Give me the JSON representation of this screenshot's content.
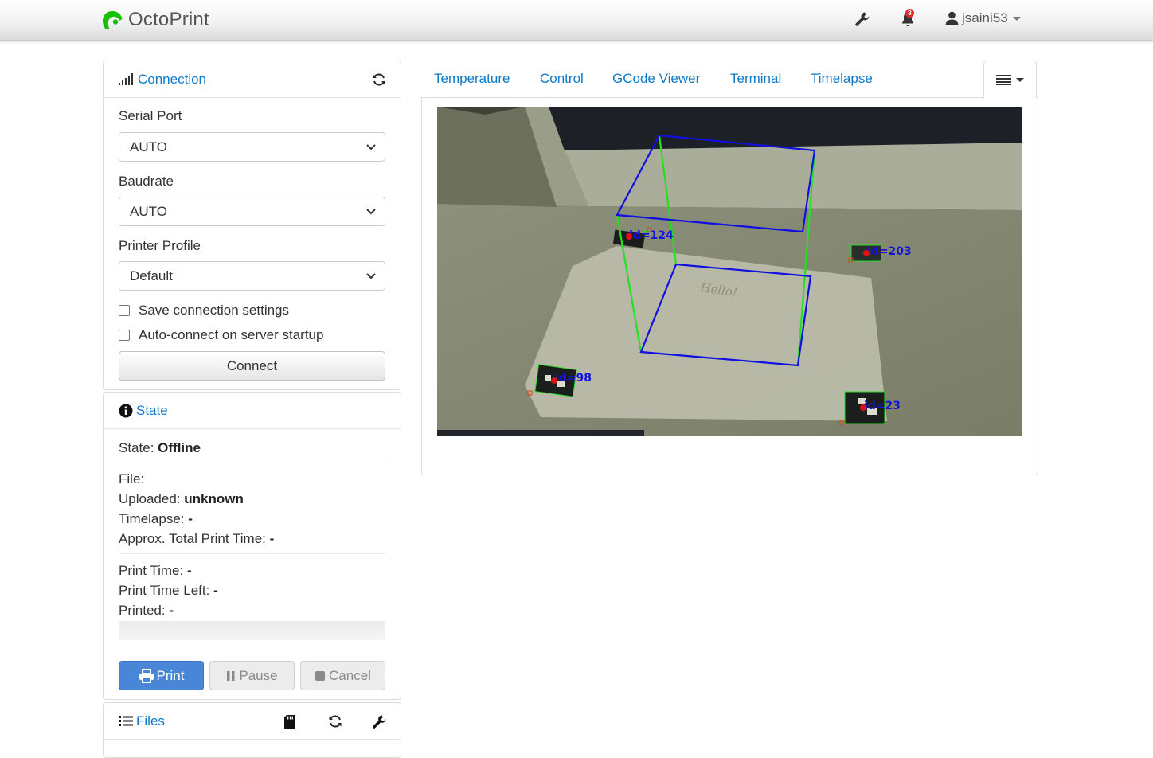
{
  "app": {
    "brand": "OctoPrint"
  },
  "navbar": {
    "settings_icon": "wrench-icon",
    "notifications_count": "8",
    "username": "jsaini53"
  },
  "connection": {
    "title": "Connection",
    "serial_port": {
      "label": "Serial Port",
      "value": "AUTO"
    },
    "baudrate": {
      "label": "Baudrate",
      "value": "AUTO"
    },
    "printer_profile": {
      "label": "Printer Profile",
      "value": "Default"
    },
    "save_settings_label": "Save connection settings",
    "autoconnect_label": "Auto-connect on server startup",
    "connect_button": "Connect"
  },
  "state": {
    "title": "State",
    "state_label": "State:",
    "state_value": "Offline",
    "file_label": "File:",
    "uploaded_label": "Uploaded:",
    "uploaded_value": "unknown",
    "timelapse_label": "Timelapse:",
    "timelapse_value": "-",
    "total_time_label": "Approx. Total Print Time:",
    "total_time_value": "-",
    "print_time_label": "Print Time:",
    "print_time_value": "-",
    "time_left_label": "Print Time Left:",
    "time_left_value": "-",
    "printed_label": "Printed:",
    "printed_value": "-",
    "progress": 0,
    "print_button": "Print",
    "pause_button": "Pause",
    "cancel_button": "Cancel"
  },
  "files": {
    "title": "Files"
  },
  "tabs": [
    "Temperature",
    "Control",
    "GCode Viewer",
    "Terminal",
    "Timelapse"
  ],
  "webcam": {
    "markers": [
      "id=124",
      "id=203",
      "id=98",
      "id=23"
    ],
    "paper_text": "Hello!"
  },
  "colors": {
    "accent": "#0e7ac8",
    "primary_button": "#4a86d8",
    "logo_green": "#13c100",
    "cube_blue": "#1010e0",
    "cube_green": "#22e022"
  }
}
